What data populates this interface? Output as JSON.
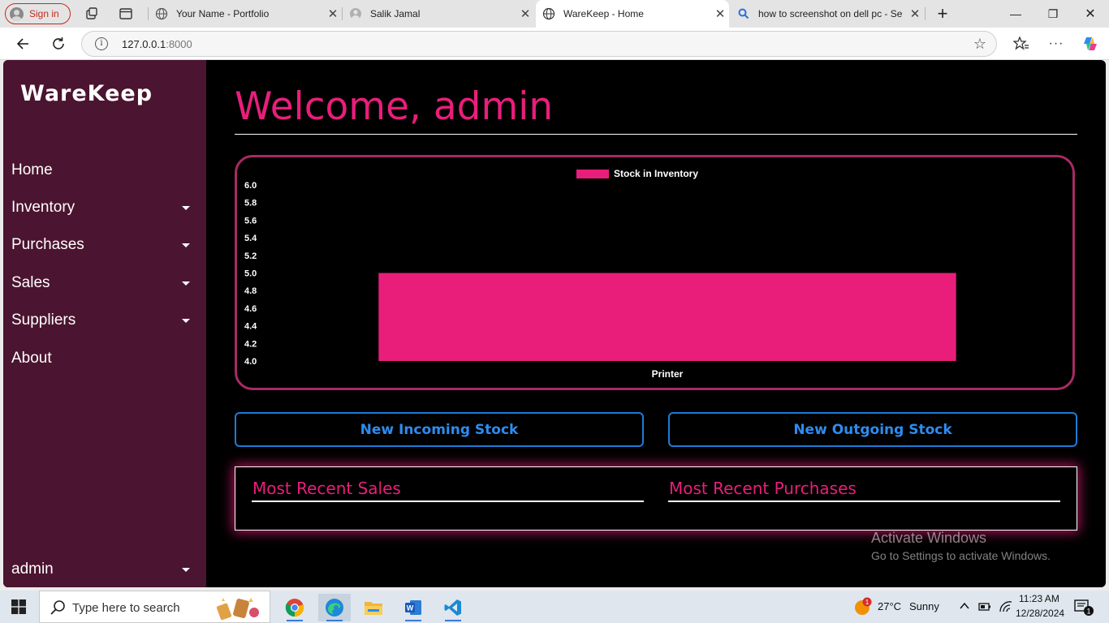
{
  "browser": {
    "signin_label": "Sign in",
    "tabs": [
      {
        "title": "Your Name - Portfolio",
        "icon": "globe-icon"
      },
      {
        "title": "Salik Jamal",
        "icon": "avatar-icon"
      },
      {
        "title": "WareKeep - Home",
        "icon": "globe-icon",
        "active": true
      },
      {
        "title": "how to screenshot on dell pc - Se",
        "icon": "search-icon"
      }
    ],
    "url_host": "127.0.0.1",
    "url_port": ":8000"
  },
  "sidebar": {
    "brand": "WareKeep",
    "items": [
      {
        "label": "Home",
        "dropdown": false
      },
      {
        "label": "Inventory",
        "dropdown": true
      },
      {
        "label": "Purchases",
        "dropdown": true
      },
      {
        "label": "Sales",
        "dropdown": true
      },
      {
        "label": "Suppliers",
        "dropdown": true
      },
      {
        "label": "About",
        "dropdown": false
      }
    ],
    "user": "admin"
  },
  "main": {
    "welcome": "Welcome, admin",
    "new_incoming": "New Incoming Stock",
    "new_outgoing": "New Outgoing Stock",
    "recent_sales_title": "Most Recent Sales",
    "recent_purchases_title": "Most Recent Purchases"
  },
  "chart_data": {
    "type": "bar",
    "categories": [
      "Printer"
    ],
    "series": [
      {
        "name": "Stock in Inventory",
        "values": [
          5
        ],
        "color": "#e91e7b"
      }
    ],
    "ylim": [
      4.0,
      6.0
    ],
    "yticks": [
      "4.0",
      "4.2",
      "4.4",
      "4.6",
      "4.8",
      "5.0",
      "5.2",
      "5.4",
      "5.6",
      "5.8",
      "6.0"
    ],
    "legend": "top-center",
    "grid": false
  },
  "watermark": {
    "line1": "Activate Windows",
    "line2": "Go to Settings to activate Windows."
  },
  "taskbar": {
    "search_placeholder": "Type here to search",
    "weather_temp": "27°C",
    "weather_desc": "Sunny",
    "weather_badge": "1",
    "time": "11:23 AM",
    "date": "12/28/2024",
    "notification_count": "1"
  },
  "colors": {
    "accent": "#e91e7b",
    "sidebar_bg": "#4b1430",
    "button_blue": "#2d8cf0"
  }
}
